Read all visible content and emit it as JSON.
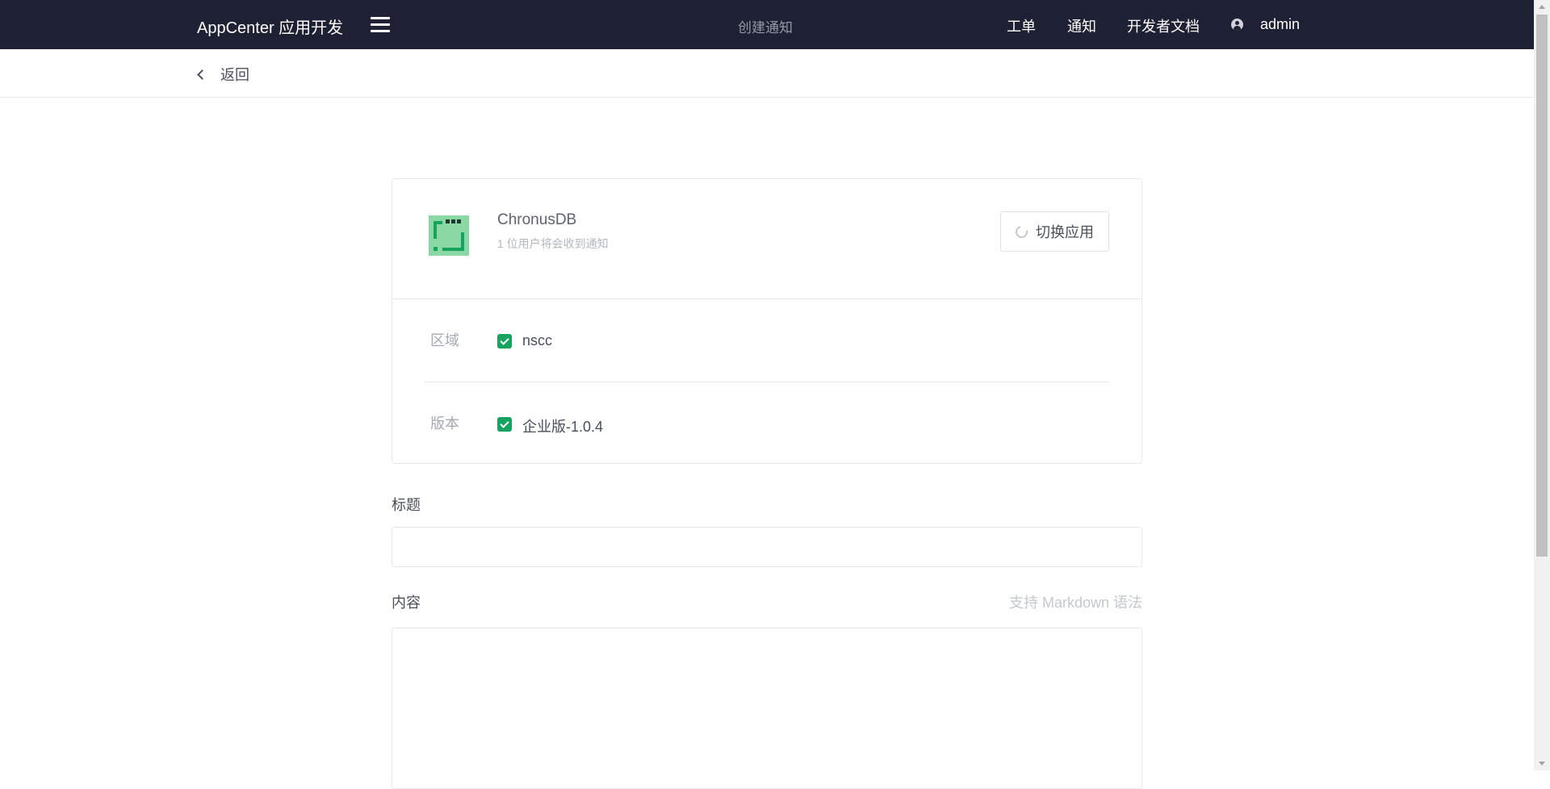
{
  "header": {
    "brand": "AppCenter 应用开发",
    "page_title": "创建通知",
    "nav": [
      "工单",
      "通知",
      "开发者文档"
    ],
    "user": "admin"
  },
  "subbar": {
    "back_label": "返回"
  },
  "app": {
    "name": "ChronusDB",
    "recipients_note": "1 位用户将会收到通知",
    "switch_label": "切换应用"
  },
  "filters": {
    "region": {
      "label": "区域",
      "option": "nscc",
      "checked": true
    },
    "version": {
      "label": "版本",
      "option": "企业版-1.0.4",
      "checked": true
    }
  },
  "form": {
    "title_label": "标题",
    "title_value": "",
    "content_label": "内容",
    "content_hint": "支持 Markdown 语法",
    "content_value": ""
  },
  "colors": {
    "header_bg": "#1e2133",
    "accent": "#15a35f"
  },
  "icons": [
    "menu-icon",
    "user-icon",
    "chevron-left-icon",
    "refresh-icon",
    "app-logo",
    "checkbox-checked-icon"
  ]
}
